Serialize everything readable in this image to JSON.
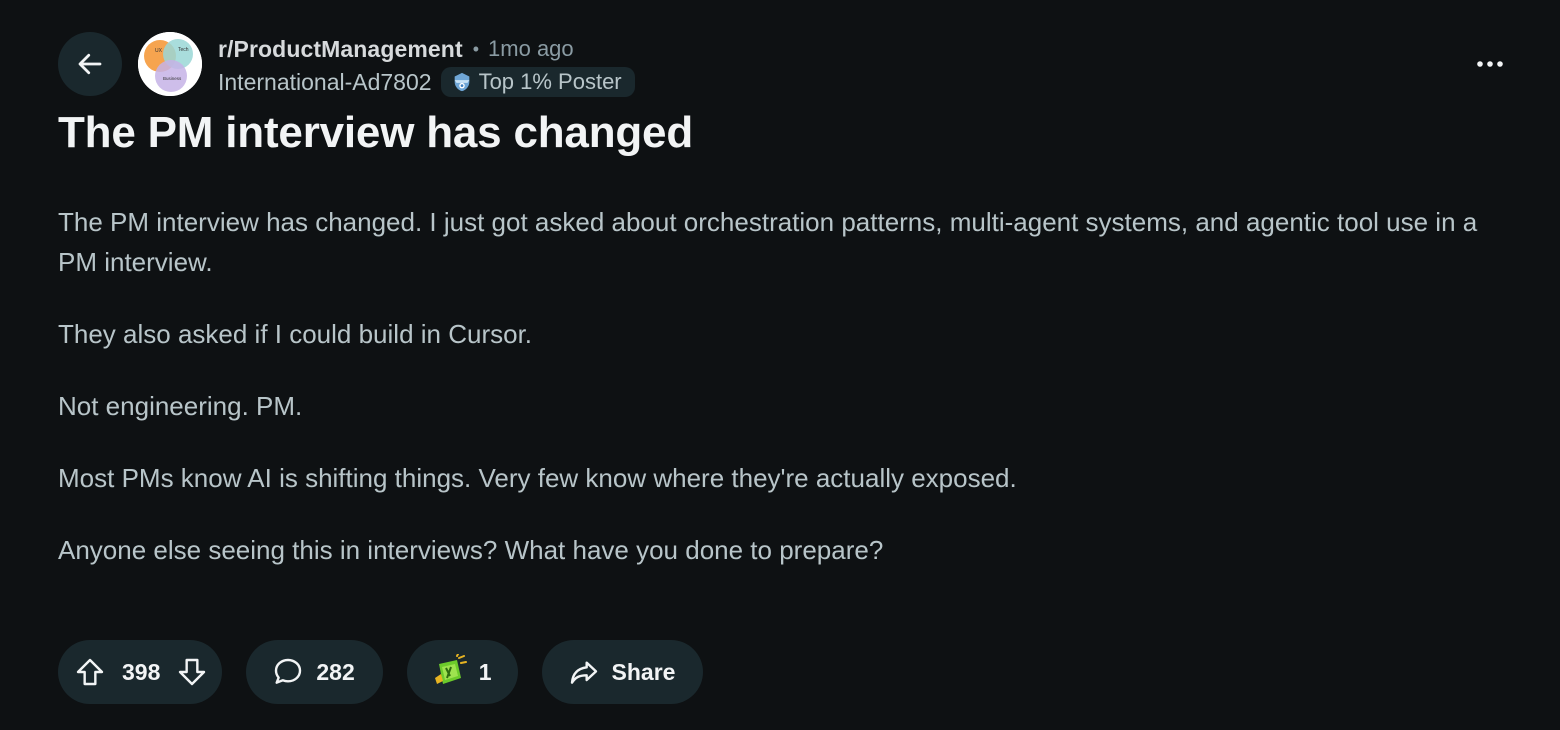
{
  "header": {
    "subreddit": "r/ProductManagement",
    "separator": "•",
    "time_ago": "1mo ago",
    "username": "International-Ad7802",
    "flair_label": "Top 1% Poster",
    "avatar_labels": [
      "UX",
      "Tech",
      "Business"
    ]
  },
  "post": {
    "title": "The PM interview has changed",
    "paragraphs": [
      "The PM interview has changed. I just got asked about orchestration patterns, multi-agent systems, and agentic tool use in a PM interview.",
      "They also asked if I could build in Cursor.",
      "Not engineering. PM.",
      "Most PMs know AI is shifting things. Very few know where they're actually exposed.",
      "Anyone else seeing this in interviews? What have you done to prepare?"
    ]
  },
  "actions": {
    "vote_count": "398",
    "comment_count": "282",
    "award_count": "1",
    "share_label": "Share"
  },
  "icons": {
    "back": "arrow-left-icon",
    "more": "more-horizontal-icon",
    "upvote": "upvote-arrow-icon",
    "downvote": "downvote-arrow-icon",
    "comment": "comment-bubble-icon",
    "award": "award-icon",
    "share": "share-arrow-icon",
    "flair": "top-poster-badge-icon"
  },
  "colors": {
    "background": "#0e1113",
    "pill": "#1a282d",
    "text_primary": "#f2f4f5",
    "text_secondary": "#b8c5c9",
    "text_muted": "#8a9ba3"
  }
}
